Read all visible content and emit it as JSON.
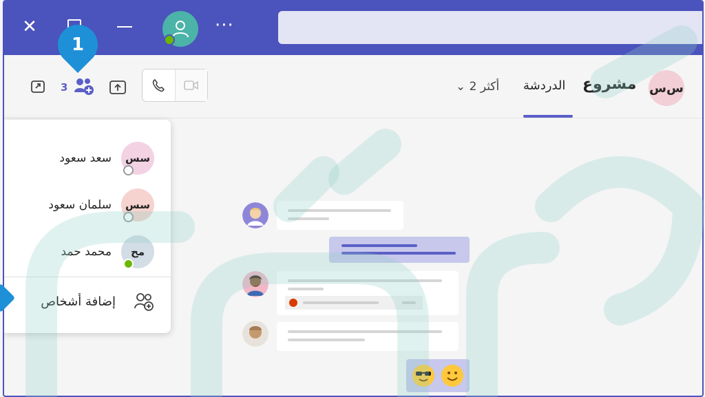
{
  "callout": {
    "number": "1"
  },
  "header": {
    "participant_count": "3",
    "title": "مشروع",
    "chat_tab": "الدردشة",
    "more_people": "2 أكثر",
    "group_avatar": "س‌س"
  },
  "participants": [
    {
      "name": "سعد سعود",
      "initials": "سس",
      "status": "offline",
      "avatar_color": "#f3d2e3"
    },
    {
      "name": "سلمان سعود",
      "initials": "سس",
      "status": "offline",
      "avatar_color": "#f6d3cf"
    },
    {
      "name": "محمد حمد",
      "initials": "مح",
      "status": "online",
      "avatar_color": "#d3dde6"
    }
  ],
  "add_people": {
    "label": "إضافة أشخاص"
  },
  "colors": {
    "brand": "#4b53bc",
    "accent": "#5b5fc7",
    "callout": "#1e90d8",
    "online": "#6bb700",
    "my_bubble": "#c7c8ec"
  },
  "icons": {
    "close": "close-icon",
    "restore": "restore-icon",
    "minimize": "minimize-icon",
    "more": "more-icon",
    "popout": "popout-icon",
    "people": "people-icon",
    "share": "share-icon",
    "call": "phone-icon",
    "video": "video-icon",
    "add_people": "add-people-icon"
  }
}
